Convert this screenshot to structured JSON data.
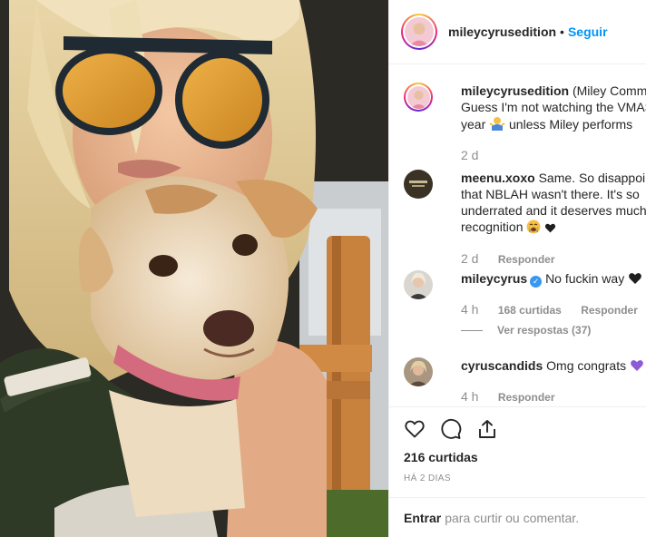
{
  "post": {
    "author": "mileycyrusedition",
    "follow_label": "Seguir",
    "dot": "•"
  },
  "caption": {
    "username": "mileycyrusedition",
    "line1": "(Miley Comments)",
    "line2": "Guess I'm not watching the VMAS this",
    "line3_before": "year",
    "line3_after": "unless Miley performs",
    "emoji_icon": "person-shrugging-icon",
    "time": "2 d"
  },
  "comments": [
    {
      "username": "meenu.xoxo",
      "line1": "Same. So disappointed",
      "line2": "that NBLAH wasn't there. It's so",
      "line3": "underrated and it deserves much more",
      "line4_before": "recognition",
      "emoji_icons": [
        "loudly-crying-face-icon",
        "black-heart-icon"
      ],
      "time": "2 d",
      "reply_label": "Responder"
    },
    {
      "username": "mileycyrus",
      "verified": true,
      "text": "No fuckin way",
      "emoji_icon": "black-heart-icon",
      "time": "4 h",
      "likes": "168 curtidas",
      "reply_label": "Responder",
      "view_replies": "Ver respostas (37)"
    },
    {
      "username": "cyruscandids",
      "text": "Omg congrats",
      "emoji_icon": "purple-heart-icon",
      "time": "4 h",
      "reply_label": "Responder"
    }
  ],
  "actions": {
    "likes": "216 curtidas",
    "date": "HÁ 2 DIAS"
  },
  "login": {
    "link": "Entrar",
    "text": "para curtir ou comentar."
  },
  "colors": {
    "link_blue": "#0095f6",
    "text": "#262626",
    "muted": "#8e8e8e",
    "border": "#efefef",
    "verified": "#3897f0",
    "purple_heart": "#8e5bd6"
  }
}
